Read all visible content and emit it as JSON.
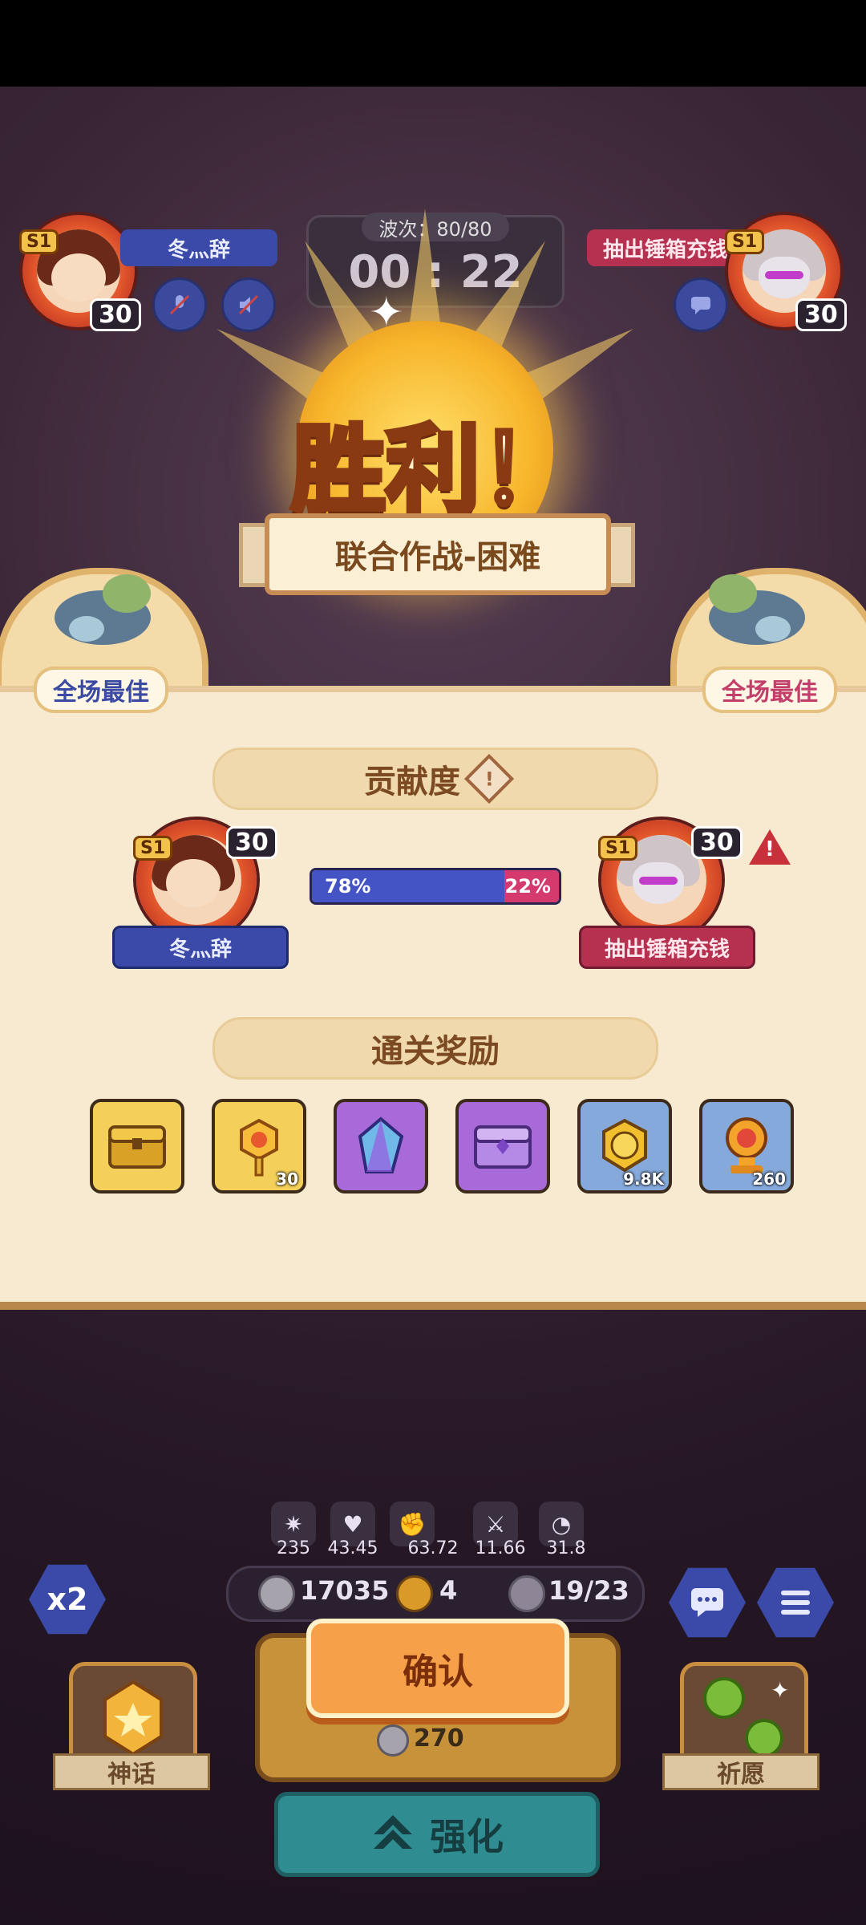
{
  "top": {
    "left_player": {
      "rank": "S1",
      "level": "30",
      "name": "冬灬辞"
    },
    "right_player": {
      "rank": "S1",
      "level": "30",
      "name": "抽出锤箱充钱"
    },
    "wave": "波次：80/80",
    "timer": "00 : 22"
  },
  "victory": {
    "title": "胜利！",
    "mode": "联合作战-困难"
  },
  "best_labels": {
    "left": "全场最佳",
    "right": "全场最佳"
  },
  "contribution": {
    "header": "贡献度",
    "left": {
      "rank": "S1",
      "level": "30",
      "name": "冬灬辞",
      "percent_label": "78%"
    },
    "right": {
      "rank": "S1",
      "level": "30",
      "name": "抽出锤箱充钱",
      "percent_label": "22%"
    },
    "left_share": 0.78
  },
  "rewards": {
    "header": "通关奖励",
    "items": [
      {
        "icon": "golden-chest-icon",
        "count": ""
      },
      {
        "icon": "gold-key-icon",
        "count": "30"
      },
      {
        "icon": "crystal-icon",
        "count": ""
      },
      {
        "icon": "purple-chest-icon",
        "count": ""
      },
      {
        "icon": "gold-coin-icon",
        "count": "9.8K"
      },
      {
        "icon": "trophy-icon",
        "count": "260"
      }
    ]
  },
  "stats": [
    "235",
    "43.45",
    "63.72",
    "11.66",
    "31.8"
  ],
  "resources": {
    "silver": "17035",
    "clover": "4",
    "units": "19/23"
  },
  "buttons": {
    "speed": "x2",
    "confirm": "确认",
    "summon_cost": "270",
    "enhance": "强化",
    "myth": "神话",
    "pray": "祈愿"
  },
  "colors": {
    "accent_blue": "#4554c4",
    "accent_pink": "#d43a6e",
    "confirm_orange": "#f6a04a",
    "enhance_teal": "#2f8d92"
  }
}
